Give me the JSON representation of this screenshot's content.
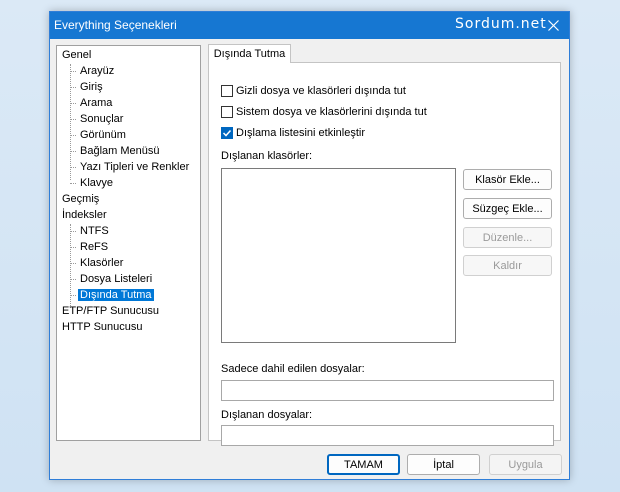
{
  "window": {
    "title": "Everything Seçenekleri",
    "watermark": "Sordum.net"
  },
  "tree": {
    "general": "Genel",
    "general_children": [
      "Arayüz",
      "Giriş",
      "Arama",
      "Sonuçlar",
      "Görünüm",
      "Bağlam Menüsü",
      "Yazı Tipleri ve Renkler",
      "Klavye"
    ],
    "history": "Geçmiş",
    "indexes": "İndeksler",
    "index_children": [
      "NTFS",
      "ReFS",
      "Klasörler",
      "Dosya Listeleri",
      "Dışında Tutma"
    ],
    "selected": "Dışında Tutma",
    "ftp": "ETP/FTP Sunucusu",
    "http": "HTTP Sunucusu"
  },
  "tab": {
    "label": "Dışında Tutma"
  },
  "options": {
    "hidden": {
      "label": "Gizli dosya ve klasörleri dışında tut",
      "checked": false
    },
    "system": {
      "label": "Sistem dosya ve klasörlerini dışında tut",
      "checked": false
    },
    "enable_list": {
      "label": "Dışlama listesini etkinleştir",
      "checked": true
    }
  },
  "excluded_folders_label": "Dışlanan klasörler:",
  "buttons": {
    "add_folder": "Klasör Ekle...",
    "add_filter": "Süzgeç Ekle...",
    "edit": "Düzenle...",
    "remove": "Kaldır"
  },
  "include_only_label": "Sadece dahil edilen dosyalar:",
  "include_only_value": "",
  "excluded_files_label": "Dışlanan dosyalar:",
  "excluded_files_value": "",
  "dialog": {
    "ok": "TAMAM",
    "cancel": "İptal",
    "apply": "Uygula"
  }
}
